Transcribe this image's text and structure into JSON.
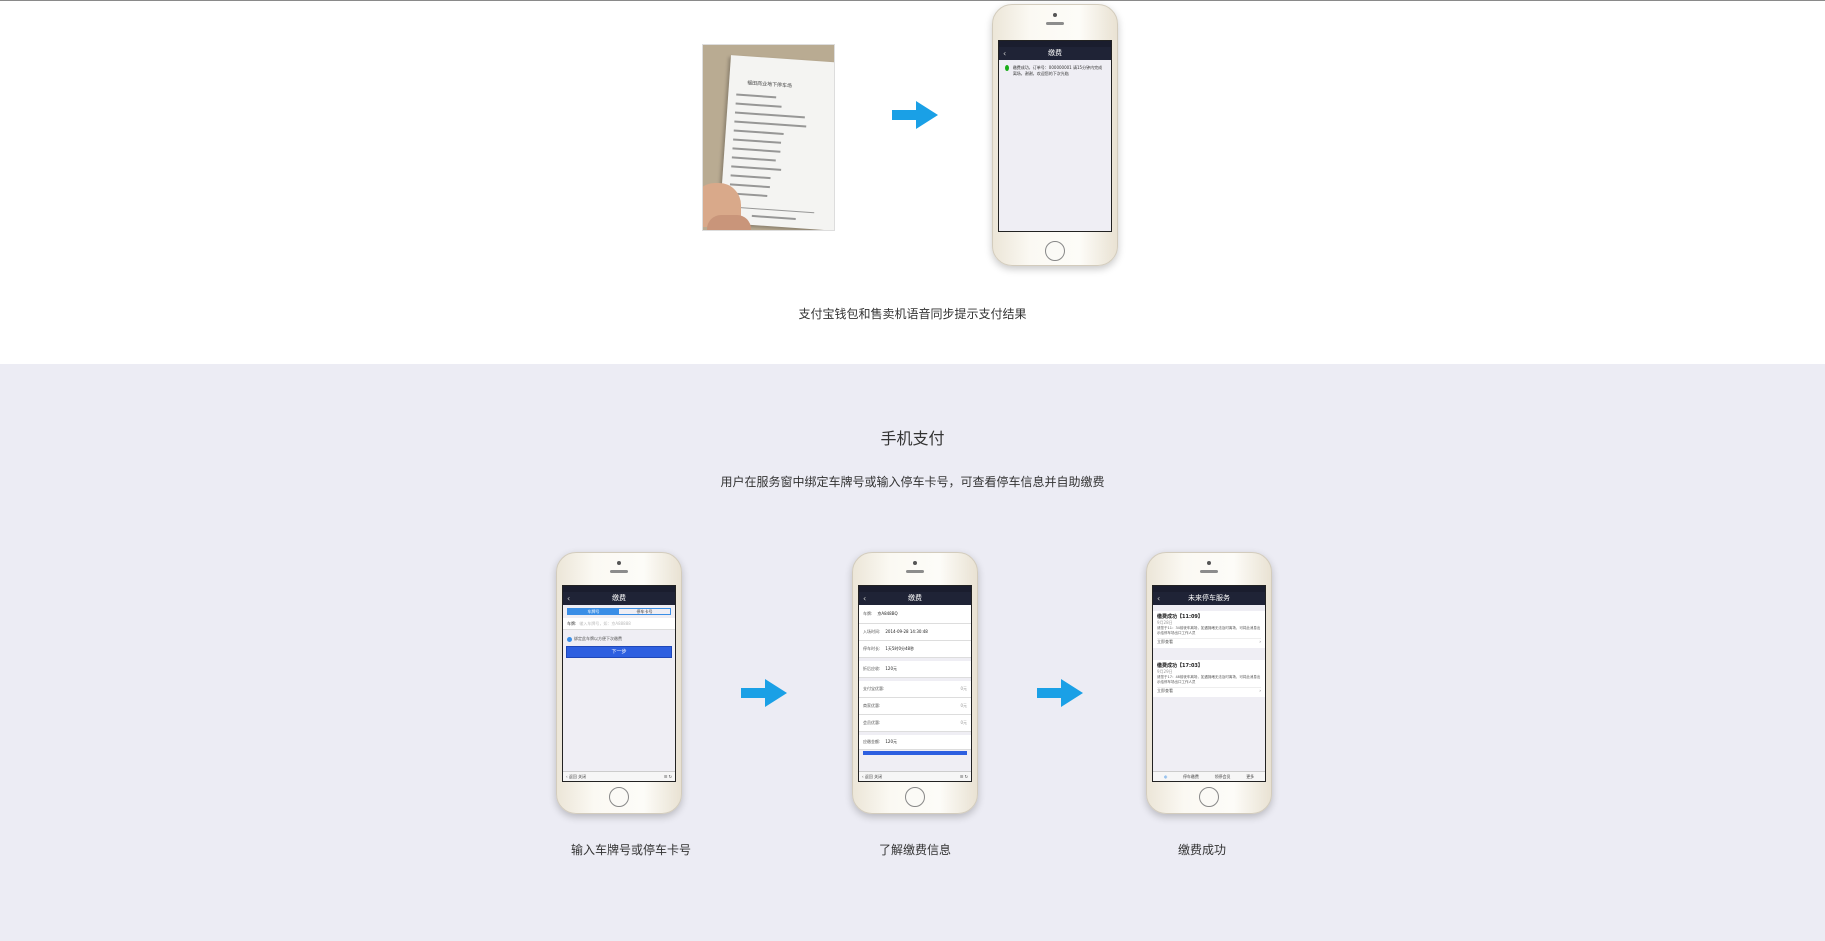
{
  "top_section": {
    "caption": "支付宝钱包和售卖机语音同步提示支付结果",
    "receipt_heading": "福田商业地下停车场",
    "success_phone": {
      "nav_title": "缴费",
      "message": "缴费成功，订单号：000000001 请15分钟内完成离场，谢谢，欢迎您的下次光临"
    }
  },
  "mobile_section": {
    "title": "手机支付",
    "subtitle": "用户在服务窗中绑定车牌号或输入停车卡号，可查看停车信息并自助缴费",
    "steps": [
      {
        "caption": "输入车牌号或停车卡号",
        "nav_title": "缴费",
        "tab_plate": "车牌号",
        "tab_card": "停车卡号",
        "plate_label": "车牌:",
        "plate_placeholder": "输入车牌号，如：京A88888",
        "bind_hint": "绑定此车牌以方便下次缴费",
        "next_button": "下一步",
        "toolbar_back": "返回",
        "toolbar_close": "关闭"
      },
      {
        "caption": "了解缴费信息",
        "nav_title": "缴费",
        "rows": [
          {
            "label": "车牌:",
            "value": "京A848BQ"
          },
          {
            "label": "入场时间:",
            "value": "2014-09-28 14:30:48"
          },
          {
            "label": "停车时长:",
            "value": "1天5时0分48秒"
          },
          {
            "label": "折后应收:",
            "value": "120元"
          },
          {
            "label": "支付宝优惠:",
            "value": "0元"
          },
          {
            "label": "商家优惠:",
            "value": "0元"
          },
          {
            "label": "会员优惠:",
            "value": "0元"
          },
          {
            "label": "应缴金额:",
            "value": "120元"
          }
        ],
        "toolbar_back": "返回",
        "toolbar_close": "关闭"
      },
      {
        "caption": "缴费成功",
        "nav_title": "未来停车服务",
        "cards": [
          {
            "title": "缴费成功【11:09】",
            "date": "9月28日",
            "body": "请您于11：34前驶车离场，如遇拥堵无法及时离场，可将此消息出示给停车场出口工作人员",
            "link": "立即查看"
          },
          {
            "title": "缴费成功【17:03】",
            "date": "9月29日",
            "body": "请您于17：48前驶车离场，如遇拥堵无法及时离场，可将此消息出示给停车场出口工作人员",
            "link": "立即查看"
          }
        ],
        "menu": [
          "停车缴费",
          "领停会员",
          "更多"
        ]
      }
    ]
  },
  "colors": {
    "arrow": "#1aa0e6",
    "grey_background": "#ececf4",
    "nav_bar": "#1f2336",
    "button_blue": "#2d5fe0"
  }
}
